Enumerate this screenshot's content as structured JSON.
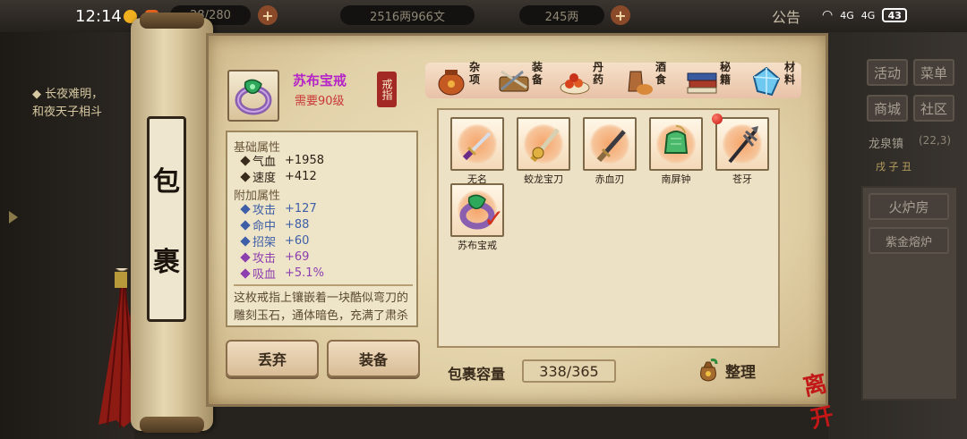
{
  "status_bar": {
    "time": "12:14",
    "battery": "43",
    "signal_1": "4G",
    "signal_2": "4G"
  },
  "top_bar": {
    "resource_1": "28/280",
    "resource_2": "2516两966文",
    "resource_3": "245两",
    "announcement": "公告"
  },
  "left_notice": {
    "line1": "◆ 长夜难明，",
    "line2": "和夜天子相斗"
  },
  "right_panel": {
    "btn_activity": "活动",
    "btn_menu": "菜单",
    "btn_shop": "商城",
    "btn_community": "社区",
    "location": "龙泉镇",
    "coords": "(22,3)",
    "time_marker": "戌 子 丑",
    "btn_furnace": "火炉房",
    "btn_gold_furnace": "紫金熔炉"
  },
  "scroll": {
    "title_char_1": "包",
    "title_char_2": "裹",
    "leave": "离开"
  },
  "item": {
    "name": "苏布宝戒",
    "requirement": "需要90级",
    "type": "戒指",
    "base_title": "基础属性",
    "base": [
      {
        "label": "气血",
        "value": "+1958"
      },
      {
        "label": "速度",
        "value": "+412"
      }
    ],
    "extra_title": "附加属性",
    "extra": [
      {
        "label": "攻击",
        "value": "+127",
        "color": "#3e5fa8"
      },
      {
        "label": "命中",
        "value": "+88",
        "color": "#3e5fa8"
      },
      {
        "label": "招架",
        "value": "+60",
        "color": "#3e5fa8"
      },
      {
        "label": "攻击",
        "value": "+69",
        "color": "#8d3fae"
      },
      {
        "label": "吸血",
        "value": "+5.1%",
        "color": "#8d3fae"
      }
    ],
    "description": "这枚戒指上镶嵌着一块酷似弯刀的雕刻玉石，通体暗色，充满了肃杀之意，好似攻击时能"
  },
  "categories": [
    {
      "label": "杂项",
      "icon": "jar-icon"
    },
    {
      "label": "装备",
      "icon": "equipment-icon"
    },
    {
      "label": "丹药",
      "icon": "pills-icon"
    },
    {
      "label": "酒食",
      "icon": "wine-food-icon"
    },
    {
      "label": "秘籍",
      "icon": "books-icon"
    },
    {
      "label": "材料",
      "icon": "crystal-icon"
    }
  ],
  "actions": {
    "discard": "丢弃",
    "equip": "装备"
  },
  "inventory": {
    "items": [
      {
        "name": "无名",
        "icon": "dagger-icon"
      },
      {
        "name": "蛟龙宝刀",
        "icon": "dragon-sword-icon"
      },
      {
        "name": "赤血刃",
        "icon": "blade-icon"
      },
      {
        "name": "南屏钟",
        "icon": "bell-icon"
      },
      {
        "name": "苍牙",
        "icon": "spear-icon"
      },
      {
        "name": "苏布宝戒",
        "icon": "ring-icon"
      }
    ],
    "capacity_label": "包裹容量",
    "capacity_value": "338/365",
    "sort_label": "整理"
  },
  "colors": {
    "item_name": "#b424c8",
    "requirement": "#c83838",
    "accent_red": "#a32a24"
  }
}
